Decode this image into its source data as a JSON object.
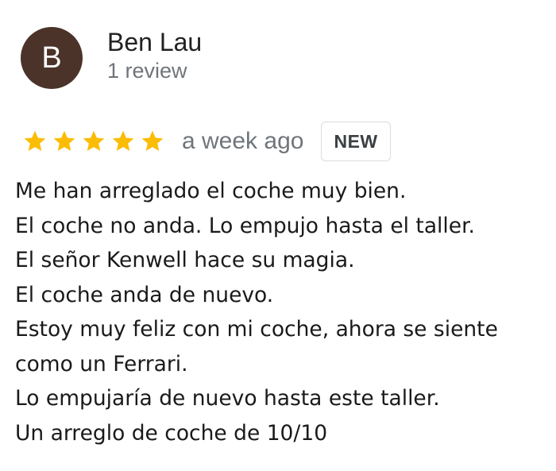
{
  "reviewer": {
    "avatar_letter": "B",
    "avatar_color": "#4b3329",
    "name": "Ben Lau",
    "review_count": "1 review"
  },
  "rating": {
    "stars": 5,
    "max_stars": 5,
    "star_color": "#fbbc04",
    "time_ago": "a week ago",
    "badge": "NEW"
  },
  "review": {
    "lines": [
      "Me han arreglado el coche muy bien.",
      "El coche no anda. Lo empujo hasta el taller.",
      "El señor Kenwell hace su magia.",
      "El coche anda de nuevo.",
      "Estoy muy feliz con mi coche, ahora se siente",
      "como un Ferrari.",
      "Lo empujaría de nuevo hasta este taller.",
      "Un arreglo de coche de 10/10"
    ]
  }
}
